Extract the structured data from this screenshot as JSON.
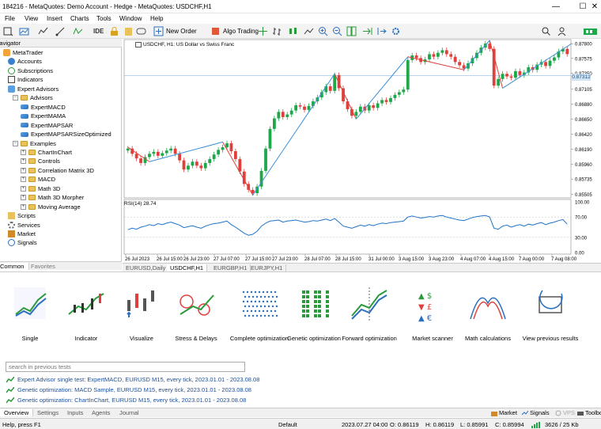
{
  "window": {
    "title": "184216 - MetaQuotes: Demo Account - Hedge - MetaQuotes: USDCHF,H1"
  },
  "menu": [
    "File",
    "View",
    "Insert",
    "Charts",
    "Tools",
    "Window",
    "Help"
  ],
  "toolbar": {
    "ide": "IDE",
    "new_order": "New Order",
    "algo_trading": "Algo Trading"
  },
  "navigator": {
    "title": "Navigator",
    "items": [
      {
        "label": "MetaTrader",
        "level": 0
      },
      {
        "label": "Accounts",
        "level": 1
      },
      {
        "label": "Subscriptions",
        "level": 1
      },
      {
        "label": "Indicators",
        "level": 1
      },
      {
        "label": "Expert Advisors",
        "level": 1
      },
      {
        "label": "Advisors",
        "level": 2
      },
      {
        "label": "ExpertMACD",
        "level": 3
      },
      {
        "label": "ExpertMAMA",
        "level": 3
      },
      {
        "label": "ExpertMAPSAR",
        "level": 3
      },
      {
        "label": "ExpertMAPSARSizeOptimized",
        "level": 3
      },
      {
        "label": "Examples",
        "level": 2
      },
      {
        "label": "ChartInChart",
        "level": 3
      },
      {
        "label": "Controls",
        "level": 3
      },
      {
        "label": "Correlation Matrix 3D",
        "level": 3
      },
      {
        "label": "MACD",
        "level": 3
      },
      {
        "label": "Math 3D",
        "level": 3
      },
      {
        "label": "Math 3D Morpher",
        "level": 3
      },
      {
        "label": "Moving Average",
        "level": 3
      },
      {
        "label": "Scripts",
        "level": 1
      },
      {
        "label": "Services",
        "level": 1
      },
      {
        "label": "Market",
        "level": 1
      },
      {
        "label": "Signals",
        "level": 1
      }
    ],
    "tabs": [
      "Common",
      "Favorites"
    ]
  },
  "chart": {
    "symbol_caption": "USDCHF, H1:  US Dollar vs Swiss Franc",
    "current_price": "0.87312",
    "price_ticks": [
      "0.87800",
      "0.87575",
      "0.87350",
      "0.87105",
      "0.86880",
      "0.86650",
      "0.86420",
      "0.86190",
      "0.85960",
      "0.85735",
      "0.85505"
    ],
    "time_ticks": [
      "26 Jul 2023",
      "26 Jul 15:00",
      "26 Jul 23:00",
      "27 Jul 07:00",
      "27 Jul 15:00",
      "27 Jul 23:00",
      "28 Jul 07:00",
      "28 Jul 15:00",
      "31 Jul 00:00",
      "3 Aug 15:00",
      "3 Aug 23:00",
      "4 Aug 07:00",
      "4 Aug 15:00",
      "7 Aug 00:00",
      "7 Aug 08:00"
    ],
    "rsi_label": "RSI(14) 28.74",
    "rsi_ticks": [
      "100.00",
      "70.00",
      "30.00",
      "0.00"
    ],
    "tabs": [
      "EURUSD,Daily",
      "USDCHF,H1",
      "EURGBP,H1",
      "EURJPY,H1"
    ],
    "active_tab": 1,
    "colors": {
      "bull": "#1fa84a",
      "bear": "#e0403c",
      "zz_down": "#e0403c",
      "zz_up": "#3a8fd8",
      "rsi": "#1e73c8"
    }
  },
  "chart_data": {
    "type": "candlestick",
    "price_range": [
      0.8546,
      0.8785
    ],
    "closes": [
      0.862,
      0.8612,
      0.8605,
      0.8598,
      0.8607,
      0.8612,
      0.8615,
      0.8609,
      0.8613,
      0.8617,
      0.862,
      0.8612,
      0.8602,
      0.8588,
      0.8594,
      0.86,
      0.8594,
      0.859,
      0.8598,
      0.8604,
      0.8611,
      0.8618,
      0.8622,
      0.8628,
      0.8616,
      0.8604,
      0.8585,
      0.8566,
      0.8557,
      0.8552,
      0.8562,
      0.8586,
      0.862,
      0.865,
      0.8666,
      0.8676,
      0.8668,
      0.8672,
      0.8678,
      0.8686,
      0.8684,
      0.8679,
      0.8685,
      0.8692,
      0.8698,
      0.8706,
      0.8715,
      0.8708,
      0.8732,
      0.8712,
      0.8692,
      0.868,
      0.867,
      0.8676,
      0.8684,
      0.8678,
      0.8686,
      0.8682,
      0.8689,
      0.8694,
      0.8691,
      0.8697,
      0.8702,
      0.8706,
      0.871,
      0.8755,
      0.8762,
      0.8758,
      0.8752,
      0.8756,
      0.8764,
      0.876,
      0.8766,
      0.877,
      0.8764,
      0.876,
      0.8752,
      0.8747,
      0.8742,
      0.875,
      0.8758,
      0.8766,
      0.8774,
      0.878,
      0.8772,
      0.8716,
      0.8726,
      0.8734,
      0.873,
      0.8728,
      0.8738,
      0.8732,
      0.8736,
      0.8744,
      0.874,
      0.8748,
      0.8752,
      0.8746,
      0.8754,
      0.8759,
      0.8768,
      0.8772,
      0.8764
    ],
    "zigzag": [
      [
        0,
        0.8622
      ],
      [
        5,
        0.86
      ],
      [
        22,
        0.863
      ],
      [
        29,
        0.8549
      ],
      [
        48,
        0.8734
      ],
      [
        53,
        0.8665
      ],
      [
        65,
        0.876
      ],
      [
        78,
        0.874
      ],
      [
        84,
        0.8785
      ],
      [
        87,
        0.8712
      ],
      [
        103,
        0.878
      ]
    ],
    "rsi": [
      45,
      48,
      46,
      50,
      52,
      55,
      53,
      57,
      55,
      58,
      60,
      57,
      54,
      49,
      51,
      53,
      50,
      48,
      52,
      55,
      57,
      58,
      60,
      62,
      55,
      50,
      44,
      38,
      34,
      36,
      42,
      52,
      58,
      62,
      63,
      64,
      60,
      62,
      63,
      64,
      62,
      60,
      61,
      63,
      62,
      64,
      66,
      63,
      67,
      60,
      52,
      50,
      48,
      51,
      54,
      52,
      55,
      53,
      56,
      58,
      57,
      59,
      60,
      61,
      62,
      70,
      72,
      70,
      68,
      69,
      71,
      70,
      72,
      73,
      70,
      68,
      66,
      64,
      63,
      66,
      69,
      71,
      72,
      73,
      70,
      48,
      46,
      52,
      54,
      50,
      53,
      55,
      52,
      56,
      54,
      57,
      59,
      55,
      58,
      60,
      63,
      65,
      56
    ]
  },
  "tester": {
    "modes": [
      "Single",
      "Indicator",
      "Visualize",
      "Stress & Delays",
      "Complete optimization",
      "Genetic optimization",
      "Forward optimization",
      "Market scanner",
      "Math calculations",
      "View previous results"
    ],
    "search_placeholder": "search in previous tests",
    "history": [
      "Expert Advisor single test: ExpertMACD, EURUSD M15, every tick, 2023.01.01 - 2023.08.08",
      "Genetic optimization: MACD Sample, EURUSD M15, every tick, 2023.01.01 - 2023.08.08",
      "Genetic optimization: ChartInChart, EURUSD M15, every tick, 2023.01.01 - 2023.08.08"
    ],
    "tabs": [
      "Overview",
      "Settings",
      "Inputs",
      "Agents",
      "Journal"
    ],
    "right_tabs": [
      "Market",
      "Signals",
      "VPS",
      "Toolbox"
    ]
  },
  "status": {
    "help": "Help, press F1",
    "profile": "Default",
    "time": "2023.07.27 04:00",
    "open": "O: 0.86119",
    "high": "H: 0.86119",
    "low": "L: 0.85991",
    "close": "C: 0.85994",
    "traffic": "3626 / 25 Kb"
  }
}
